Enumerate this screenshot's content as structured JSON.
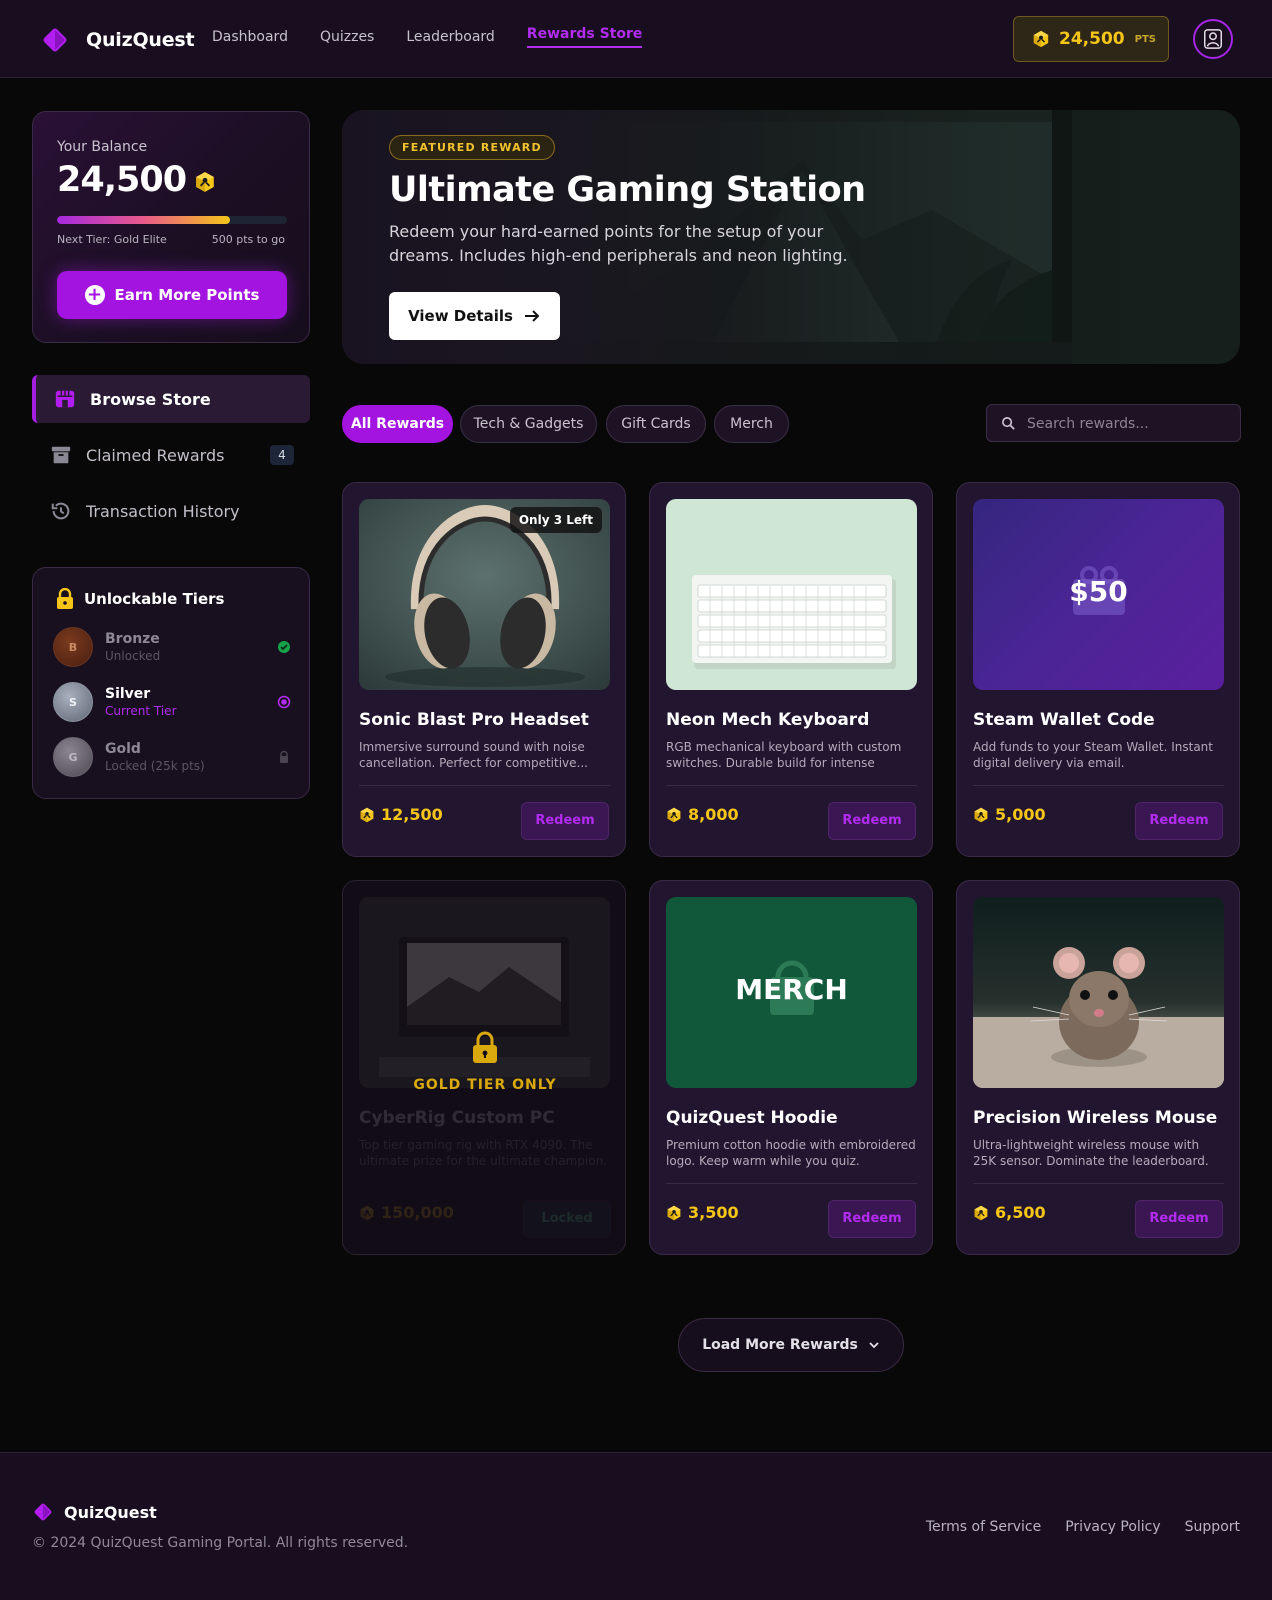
{
  "header": {
    "brand": "QuizQuest",
    "nav": [
      "Dashboard",
      "Quizzes",
      "Leaderboard",
      "Rewards Store"
    ],
    "active_nav": "Rewards Store",
    "points": "24,500",
    "points_unit": "PTS"
  },
  "sidebar": {
    "balance_label": "Your Balance",
    "balance_value": "24,500",
    "progress_fraction": 0.75,
    "next_tier": "Next Tier: Gold Elite",
    "to_go": "500 pts to go",
    "earn_button": "Earn More Points",
    "nav": [
      {
        "label": "Browse Store",
        "icon": "store-icon",
        "active": true
      },
      {
        "label": "Claimed Rewards",
        "icon": "archive-icon",
        "badge": "4"
      },
      {
        "label": "Transaction History",
        "icon": "history-icon"
      }
    ],
    "tiers_title": "Unlockable Tiers",
    "tiers": [
      {
        "initial": "B",
        "name": "Bronze",
        "status": "Unlocked"
      },
      {
        "initial": "S",
        "name": "Silver",
        "status": "Current Tier"
      },
      {
        "initial": "G",
        "name": "Gold",
        "status": "Locked (25k pts)"
      }
    ]
  },
  "hero": {
    "tag": "FEATURED REWARD",
    "title": "Ultimate Gaming Station",
    "description": "Redeem your hard-earned points for the setup of your dreams. Includes high-end peripherals and neon lighting.",
    "button": "View Details"
  },
  "filters": {
    "chips": [
      "All Rewards",
      "Tech & Gadgets",
      "Gift Cards",
      "Merch"
    ],
    "active": "All Rewards",
    "search_placeholder": "Search rewards..."
  },
  "products": [
    {
      "title": "Sonic Blast Pro Headset",
      "desc": "Immersive surround sound with noise cancellation. Perfect for competitive...",
      "price": "12,500",
      "action": "Redeem",
      "badge": "Only 3 Left"
    },
    {
      "title": "Neon Mech Keyboard",
      "desc": "RGB mechanical keyboard with custom switches. Durable build for intense typing.",
      "price": "8,000",
      "action": "Redeem"
    },
    {
      "title": "Steam Wallet Code",
      "desc": "Add funds to your Steam Wallet. Instant digital delivery via email.",
      "price": "5,000",
      "action": "Redeem",
      "image_text": "$50"
    },
    {
      "title": "CyberRig Custom PC",
      "desc": "Top tier gaming rig with RTX 4090. The ultimate prize for the ultimate champion.",
      "price": "150,000",
      "action": "Locked",
      "lock_label": "GOLD TIER ONLY"
    },
    {
      "title": "QuizQuest Hoodie",
      "desc": "Premium cotton hoodie with embroidered logo. Keep warm while you quiz.",
      "price": "3,500",
      "action": "Redeem",
      "image_text": "MERCH"
    },
    {
      "title": "Precision Wireless Mouse",
      "desc": "Ultra-lightweight wireless mouse with 25K sensor. Dominate the leaderboard.",
      "price": "6,500",
      "action": "Redeem"
    }
  ],
  "load_more": "Load More Rewards",
  "footer": {
    "brand": "QuizQuest",
    "copyright": "© 2024 QuizQuest Gaming Portal. All rights reserved.",
    "links": [
      "Terms of Service",
      "Privacy Policy",
      "Support"
    ]
  },
  "colors": {
    "accent": "#a414e0",
    "gold": "#f5c518",
    "background": "#080808",
    "panel": "#180e1f"
  }
}
